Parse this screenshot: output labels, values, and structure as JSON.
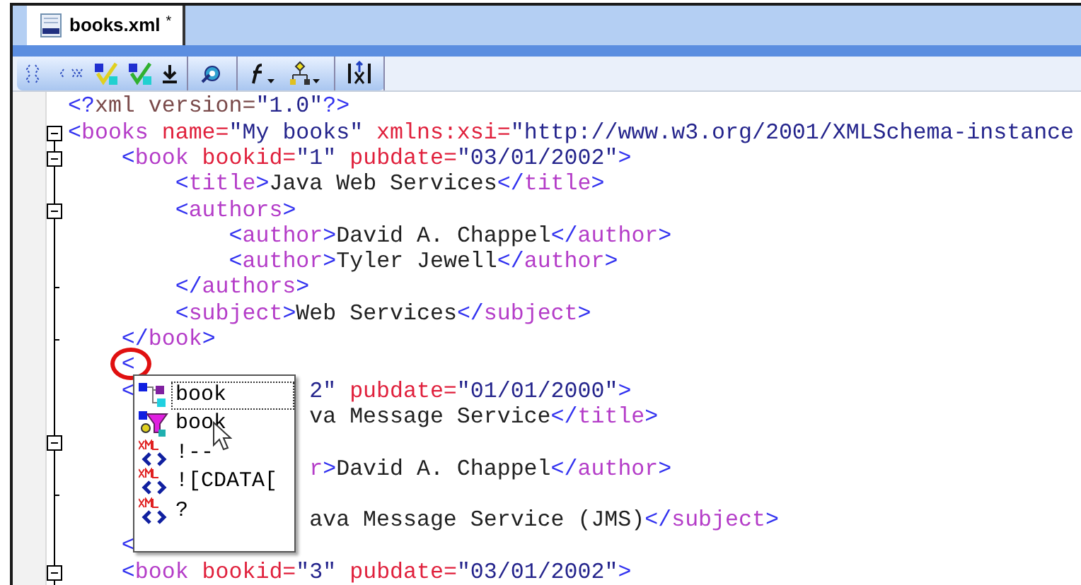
{
  "tab": {
    "label": "books.xml",
    "modified_mark": "*",
    "selected": true
  },
  "lines": [
    {
      "fold": false,
      "closes": false,
      "circled": false,
      "segments": [
        {
          "kind": "punct",
          "text": "<?"
        },
        {
          "kind": "pi",
          "text": "xml version="
        },
        {
          "kind": "value",
          "text": "\"1.0\""
        },
        {
          "kind": "punct",
          "text": "?>"
        }
      ]
    },
    {
      "fold": true,
      "closes": false,
      "circled": false,
      "segments": [
        {
          "kind": "punct",
          "text": "<"
        },
        {
          "kind": "tag",
          "text": "books"
        },
        {
          "kind": "attr",
          "text": " name="
        },
        {
          "kind": "value",
          "text": "\"My books\""
        },
        {
          "kind": "attr",
          "text": " xmlns:xsi="
        },
        {
          "kind": "value",
          "text": "\"http://www.w3.org/2001/XMLSchema-instance"
        }
      ]
    },
    {
      "fold": true,
      "closes": false,
      "circled": false,
      "segments": [
        {
          "kind": "punct",
          "text": "    <"
        },
        {
          "kind": "tag",
          "text": "book"
        },
        {
          "kind": "attr",
          "text": " bookid="
        },
        {
          "kind": "value",
          "text": "\"1\""
        },
        {
          "kind": "attr",
          "text": " pubdate="
        },
        {
          "kind": "value",
          "text": "\"03/01/2002\""
        },
        {
          "kind": "punct",
          "text": ">"
        }
      ]
    },
    {
      "fold": false,
      "closes": false,
      "circled": false,
      "segments": [
        {
          "kind": "punct",
          "text": "        <"
        },
        {
          "kind": "tag",
          "text": "title"
        },
        {
          "kind": "punct",
          "text": ">"
        },
        {
          "kind": "text",
          "text": "Java Web Services"
        },
        {
          "kind": "punct",
          "text": "</"
        },
        {
          "kind": "tag",
          "text": "title"
        },
        {
          "kind": "punct",
          "text": ">"
        }
      ]
    },
    {
      "fold": true,
      "closes": false,
      "circled": false,
      "segments": [
        {
          "kind": "punct",
          "text": "        <"
        },
        {
          "kind": "tag",
          "text": "authors"
        },
        {
          "kind": "punct",
          "text": ">"
        }
      ]
    },
    {
      "fold": false,
      "closes": false,
      "circled": false,
      "segments": [
        {
          "kind": "punct",
          "text": "            <"
        },
        {
          "kind": "tag",
          "text": "author"
        },
        {
          "kind": "punct",
          "text": ">"
        },
        {
          "kind": "text",
          "text": "David A. Chappel"
        },
        {
          "kind": "punct",
          "text": "</"
        },
        {
          "kind": "tag",
          "text": "author"
        },
        {
          "kind": "punct",
          "text": ">"
        }
      ]
    },
    {
      "fold": false,
      "closes": false,
      "circled": false,
      "segments": [
        {
          "kind": "punct",
          "text": "            <"
        },
        {
          "kind": "tag",
          "text": "author"
        },
        {
          "kind": "punct",
          "text": ">"
        },
        {
          "kind": "text",
          "text": "Tyler Jewell"
        },
        {
          "kind": "punct",
          "text": "</"
        },
        {
          "kind": "tag",
          "text": "author"
        },
        {
          "kind": "punct",
          "text": ">"
        }
      ]
    },
    {
      "fold": false,
      "closes": true,
      "circled": false,
      "segments": [
        {
          "kind": "punct",
          "text": "        </"
        },
        {
          "kind": "tag",
          "text": "authors"
        },
        {
          "kind": "punct",
          "text": ">"
        }
      ]
    },
    {
      "fold": false,
      "closes": false,
      "circled": false,
      "segments": [
        {
          "kind": "punct",
          "text": "        <"
        },
        {
          "kind": "tag",
          "text": "subject"
        },
        {
          "kind": "punct",
          "text": ">"
        },
        {
          "kind": "text",
          "text": "Web Services"
        },
        {
          "kind": "punct",
          "text": "</"
        },
        {
          "kind": "tag",
          "text": "subject"
        },
        {
          "kind": "punct",
          "text": ">"
        }
      ]
    },
    {
      "fold": false,
      "closes": true,
      "circled": false,
      "segments": [
        {
          "kind": "punct",
          "text": "    </"
        },
        {
          "kind": "tag",
          "text": "book"
        },
        {
          "kind": "punct",
          "text": ">"
        }
      ]
    },
    {
      "fold": false,
      "closes": false,
      "circled": true,
      "segments": [
        {
          "kind": "punct",
          "text": "    <"
        }
      ]
    },
    {
      "fold": false,
      "closes": false,
      "circled": false,
      "segments": [
        {
          "kind": "punct",
          "text": "    <"
        }
      ],
      "segments_after_popup": [
        {
          "kind": "value",
          "text": "2\""
        },
        {
          "kind": "attr",
          "text": " pubdate="
        },
        {
          "kind": "value",
          "text": "\"01/01/2000\""
        },
        {
          "kind": "punct",
          "text": ">"
        }
      ]
    },
    {
      "fold": false,
      "closes": false,
      "circled": false,
      "segments_after_popup": [
        {
          "kind": "text",
          "text": "va Message Service"
        },
        {
          "kind": "punct",
          "text": "</"
        },
        {
          "kind": "tag",
          "text": "title"
        },
        {
          "kind": "punct",
          "text": ">"
        }
      ]
    },
    {
      "fold": true,
      "closes": false,
      "circled": false
    },
    {
      "fold": false,
      "closes": false,
      "circled": false,
      "segments_after_popup": [
        {
          "kind": "tag",
          "text": "r"
        },
        {
          "kind": "punct",
          "text": ">"
        },
        {
          "kind": "text",
          "text": "David A. Chappel"
        },
        {
          "kind": "punct",
          "text": "</"
        },
        {
          "kind": "tag",
          "text": "author"
        },
        {
          "kind": "punct",
          "text": ">"
        }
      ]
    },
    {
      "fold": false,
      "closes": true,
      "circled": false
    },
    {
      "fold": false,
      "closes": false,
      "circled": false,
      "segments_after_popup": [
        {
          "kind": "text",
          "text": "ava Message Service (JMS)"
        },
        {
          "kind": "punct",
          "text": "</"
        },
        {
          "kind": "tag",
          "text": "subject"
        },
        {
          "kind": "punct",
          "text": ">"
        }
      ]
    },
    {
      "fold": false,
      "closes": false,
      "circled": false,
      "segments": [
        {
          "kind": "punct",
          "text": "    <"
        }
      ]
    },
    {
      "fold": true,
      "closes": false,
      "circled": false,
      "segments": [
        {
          "kind": "punct",
          "text": "    <"
        },
        {
          "kind": "tag",
          "text": "book"
        },
        {
          "kind": "attr",
          "text": " bookid="
        },
        {
          "kind": "value",
          "text": "\"3\""
        },
        {
          "kind": "attr",
          "text": " pubdate="
        },
        {
          "kind": "value",
          "text": "\"03/01/2002\""
        },
        {
          "kind": "punct",
          "text": ">"
        }
      ]
    }
  ],
  "completion_popup": {
    "items": [
      {
        "kind": "element",
        "label": "book",
        "selected": true
      },
      {
        "kind": "element_alt",
        "label": "book",
        "selected": false
      },
      {
        "kind": "xml",
        "label": "!--",
        "selected": false
      },
      {
        "kind": "xml",
        "label": "![CDATA[",
        "selected": false
      },
      {
        "kind": "xml",
        "label": "?",
        "selected": false
      }
    ]
  }
}
